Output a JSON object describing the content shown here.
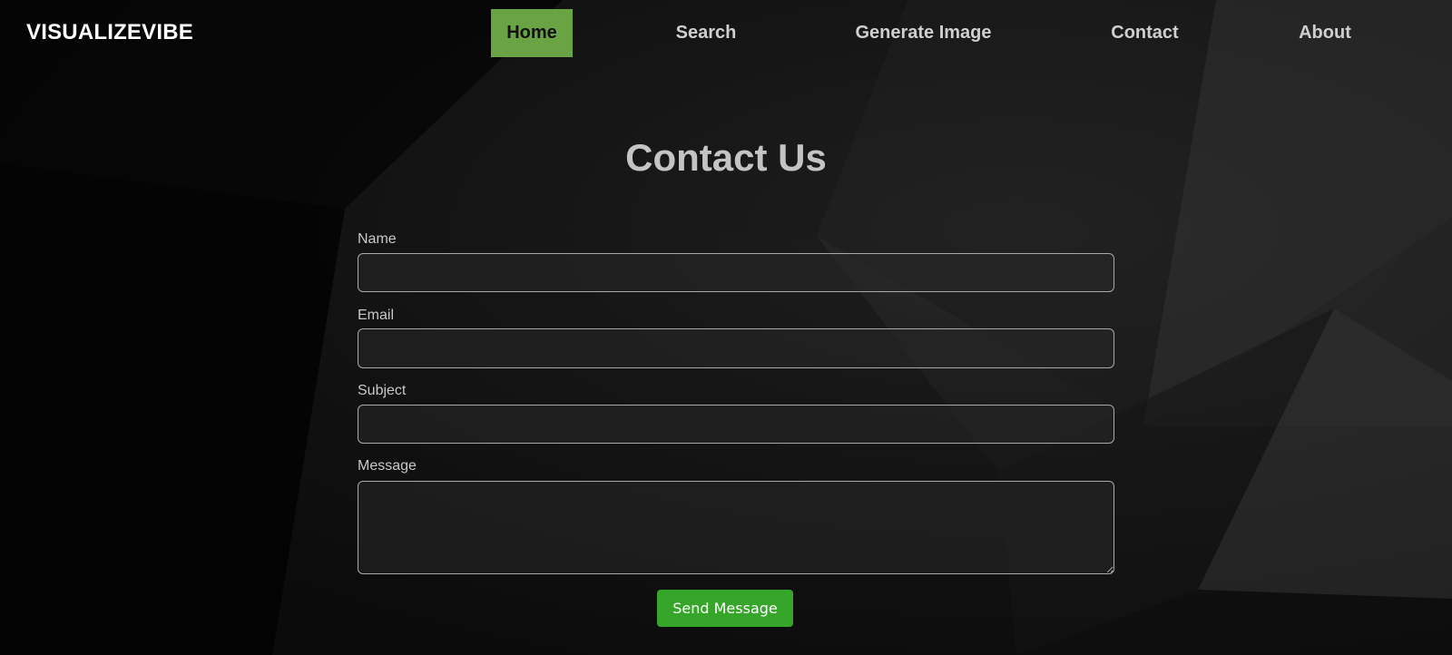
{
  "brand": "VISUALIZEVIBE",
  "nav": {
    "home": "Home",
    "search": "Search",
    "generate": "Generate Image",
    "contact": "Contact",
    "about": "About"
  },
  "page_title": "Contact Us",
  "form": {
    "name_label": "Name",
    "name_value": "",
    "email_label": "Email",
    "email_value": "",
    "subject_label": "Subject",
    "subject_value": "",
    "message_label": "Message",
    "message_value": "",
    "submit_label": "Send Message"
  },
  "colors": {
    "nav_active_bg": "#6aa343",
    "submit_bg": "#36a62a",
    "page_bg": "#0a0a0a"
  }
}
